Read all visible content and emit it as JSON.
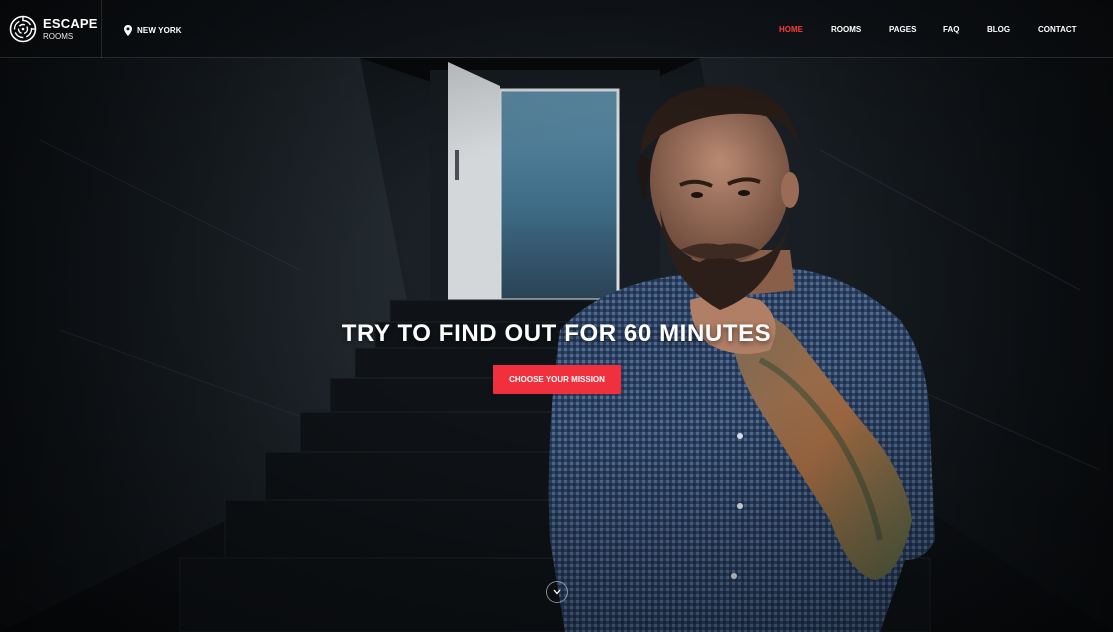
{
  "brand": {
    "title": "ESCAPE",
    "subtitle": "ROOMS",
    "logo_icon": "maze-globe-icon"
  },
  "location": {
    "icon": "map-pin-icon",
    "label": "NEW YORK"
  },
  "nav": {
    "items": [
      {
        "label": "HOME",
        "active": true
      },
      {
        "label": "ROOMS",
        "active": false
      },
      {
        "label": "PAGES",
        "active": false
      },
      {
        "label": "FAQ",
        "active": false
      },
      {
        "label": "BLOG",
        "active": false
      },
      {
        "label": "CONTACT",
        "active": false
      }
    ]
  },
  "hero": {
    "headline": "TRY TO FIND OUT FOR 60 MINUTES",
    "cta_label": "CHOOSE YOUR MISSION",
    "scroll_icon": "chevron-down-icon"
  },
  "colors": {
    "accent": "#f0303d",
    "nav_active": "#ff3a3a",
    "background": "#0b0e12"
  }
}
